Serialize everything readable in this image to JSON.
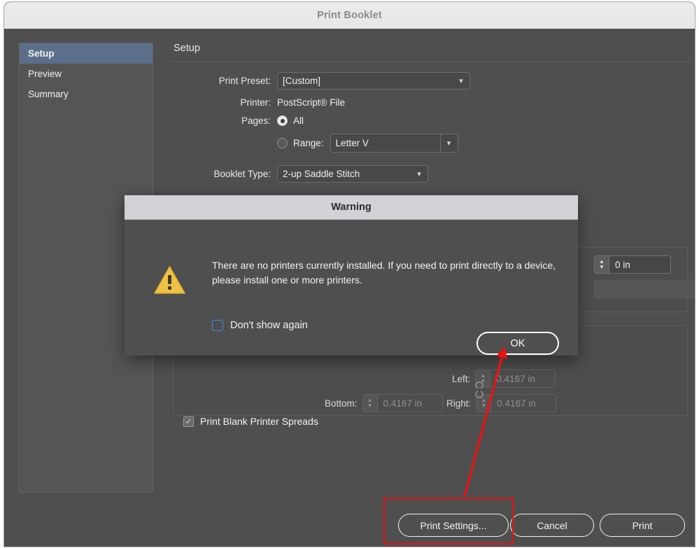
{
  "window": {
    "title": "Print Booklet"
  },
  "sidebar": {
    "items": [
      {
        "label": "Setup",
        "selected": true
      },
      {
        "label": "Preview",
        "selected": false
      },
      {
        "label": "Summary",
        "selected": false
      }
    ]
  },
  "pane": {
    "title": "Setup",
    "print_preset": {
      "label": "Print Preset:",
      "value": "[Custom]"
    },
    "printer": {
      "label": "Printer:",
      "value": "PostScript® File"
    },
    "pages": {
      "label": "Pages:",
      "all_label": "All",
      "all_selected": true,
      "range_label": "Range:",
      "range_selected": false,
      "range_value": "Letter V"
    },
    "booklet_type": {
      "label": "Booklet Type:",
      "value": "2-up Saddle Stitch"
    },
    "spacing": {
      "value": "0 in",
      "dropdown_value": ""
    },
    "margins": {
      "left_label": "Left:",
      "left_value": "0.4167 in",
      "right_label": "Right:",
      "right_value": "0.4167 in",
      "bottom_label": "Bottom:",
      "bottom_value": "0.4167 in",
      "link_icon": "broken-chain-icon"
    },
    "blank_spreads": {
      "label": "Print Blank Printer Spreads",
      "checked": true,
      "check_glyph": "✓"
    }
  },
  "footer": {
    "print_settings_label": "Print Settings...",
    "cancel_label": "Cancel",
    "print_label": "Print"
  },
  "dialog": {
    "title": "Warning",
    "icon": "warning-triangle-icon",
    "message": "There are no printers currently installed.  If you need to print directly to a device, please install one or more printers.",
    "dont_show_label": "Don't show again",
    "dont_show_checked": false,
    "ok_label": "OK"
  },
  "annotation": {
    "highlight_target": "print-settings-button",
    "arrow_from": "print-settings-button",
    "arrow_to": "ok-button",
    "color": "#ee1111"
  },
  "colors": {
    "window_bg": "#4f4f4f",
    "titlebar_bg": "#eceaec",
    "sidebar_selected": "#5b6e8a",
    "dialog_titlebar": "#d4d1d6",
    "warning_yellow": "#f0c244",
    "checkbox_blue": "#3d8bdf",
    "annotation_red": "#ee1111"
  }
}
